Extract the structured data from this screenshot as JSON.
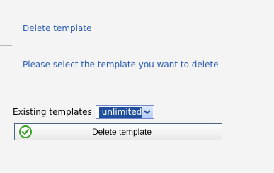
{
  "section": {
    "title": "Delete template"
  },
  "instruction": {
    "text": "Please select the template you want to delete"
  },
  "form": {
    "existing_templates_label": "Existing templates",
    "selected_template": "unlimited"
  },
  "button": {
    "label": "Delete template",
    "icon": "check-icon"
  },
  "colors": {
    "title_blue": "#2a5ab5",
    "selection_blue": "#1f4f9d",
    "button_border": "#4b6389",
    "icon_green": "#3aa02a"
  }
}
